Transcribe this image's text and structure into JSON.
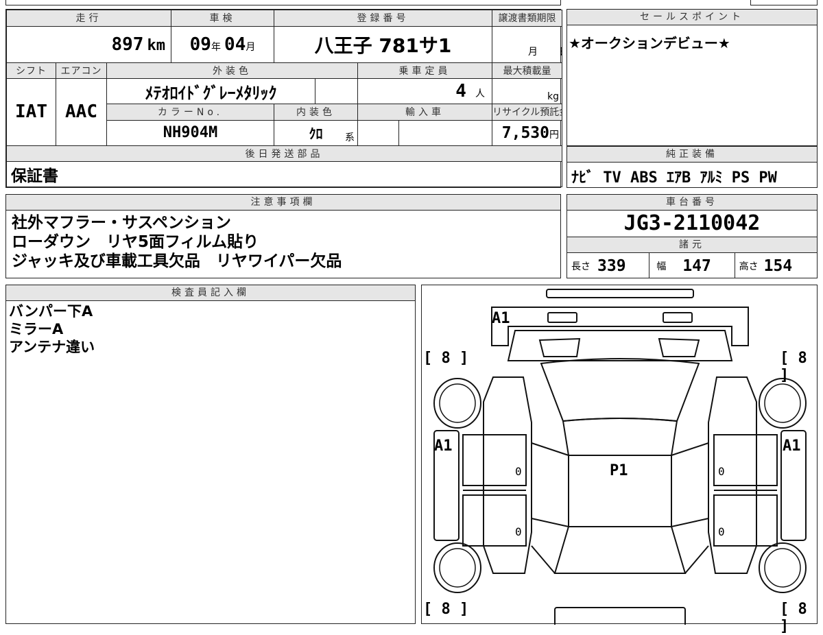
{
  "sheet": {
    "mileage": {
      "header": "走行",
      "value": "897",
      "unit": "km"
    },
    "shaken": {
      "header": "車検",
      "year": "09",
      "year_unit": "年",
      "month": "04",
      "month_unit": "月"
    },
    "registration": {
      "header": "登録番号",
      "value": "八王子 781サ1"
    },
    "transfer_deadline": {
      "header": "譲渡書類期限",
      "month_unit": "月",
      "day_unit": "日"
    },
    "shift": {
      "header": "シフト",
      "value": "IAT"
    },
    "aircon": {
      "header": "エアコン",
      "value": "AAC"
    },
    "exterior_color": {
      "header": "外装色",
      "value": "ﾒﾃｵﾛｲﾄﾞｸﾞﾚｰﾒﾀﾘｯｸ"
    },
    "capacity": {
      "header": "乗車定員",
      "value": "4",
      "unit": "人"
    },
    "max_load": {
      "header": "最大積載量",
      "unit": "kg"
    },
    "color_no": {
      "header": "カラーNo.",
      "value": "NH904M"
    },
    "interior_color": {
      "header": "内装色",
      "value": "ｸﾛ",
      "unit": "系"
    },
    "import": {
      "header": "輸入車"
    },
    "recycle": {
      "header": "リサイクル預託金",
      "value": "7,530",
      "unit": "円"
    },
    "later_parts": {
      "header": "後日発送部品",
      "value": "保証書"
    }
  },
  "sales_point": {
    "header": "セールスポイント",
    "text": "★オークションデビュー★"
  },
  "genuine_equipment": {
    "header": "純正装備",
    "text": "ﾅﾋﾞ TV ABS ｴｱB ｱﾙﾐ PS PW"
  },
  "notes": {
    "header": "注意事項欄",
    "lines": [
      "社外マフラー・サスペンション",
      "ローダウン　リヤ5面フィルム貼り",
      "ジャッキ及び車載工具欠品　リヤワイパー欠品"
    ]
  },
  "chassis": {
    "header": "車台番号",
    "value": "JG3-2110042"
  },
  "specs": {
    "header": "諸元",
    "length_label": "長さ",
    "length": "339",
    "width_label": "幅",
    "width": "147",
    "height_label": "高さ",
    "height": "154"
  },
  "inspector": {
    "header": "検査員記入欄",
    "lines": [
      "バンパー下A",
      "ミラーA",
      "アンテナ違い"
    ]
  },
  "diagram": {
    "marks": {
      "front_bumper": "A1",
      "left_side": "A1",
      "right_side": "A1",
      "roof": "P1",
      "fl_tire": "8",
      "fr_tire": "8",
      "rl_tire": "8",
      "rr_tire": "8",
      "left_front_door": "0",
      "left_rear_door": "0",
      "right_front_door": "0",
      "right_rear_door": "0"
    },
    "bracket_open": "[",
    "bracket_close": "]"
  }
}
